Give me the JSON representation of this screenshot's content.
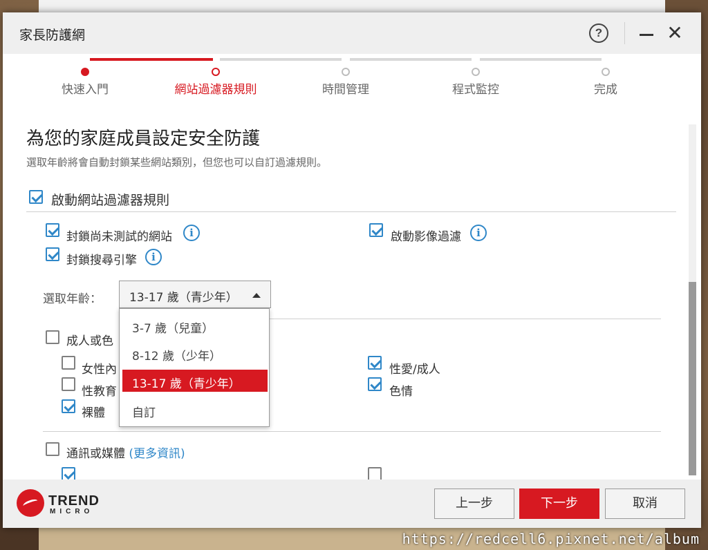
{
  "window": {
    "title": "家長防護網"
  },
  "titlebar": {
    "help_glyph": "?",
    "close_glyph": "✕"
  },
  "stepper": {
    "steps": [
      {
        "label": "快速入門",
        "state": "done"
      },
      {
        "label": "網站過濾器規則",
        "state": "current"
      },
      {
        "label": "時間管理",
        "state": "pending"
      },
      {
        "label": "程式監控",
        "state": "pending"
      },
      {
        "label": "完成",
        "state": "pending"
      }
    ]
  },
  "main": {
    "heading": "為您的家庭成員設定安全防護",
    "subheading": "選取年齡將會自動封鎖某些網站類別，但您也可以自訂過濾規則。",
    "enable_filter": {
      "label": "啟動網站過濾器規則",
      "checked": true
    },
    "options": [
      {
        "label": "封鎖尚未測試的網站",
        "checked": true,
        "info": true
      },
      {
        "label": "啟動影像過濾",
        "checked": true,
        "info": true
      },
      {
        "label": "封鎖搜尋引擎",
        "checked": true,
        "info": true
      }
    ],
    "age": {
      "label": "選取年齡：",
      "selected": "13-17 歲（青少年）",
      "options": [
        "3-7 歲（兒童）",
        "8-12 歲（少年）",
        "13-17 歲（青少年）",
        "自訂"
      ]
    },
    "categories": [
      {
        "label": "成人或色",
        "checked": false,
        "items": [
          {
            "label": "女性內",
            "checked": false
          },
          {
            "label": "性愛/成人",
            "checked": true
          },
          {
            "label": "性教育",
            "checked": false
          },
          {
            "label": "色情",
            "checked": true
          },
          {
            "label": "裸體",
            "checked": true
          }
        ]
      },
      {
        "label": "通訊或媒體",
        "more_link": "(更多資訊)",
        "checked": false
      }
    ],
    "info_glyph": "i"
  },
  "footer": {
    "logo_top": "TREND",
    "logo_bottom": "MICRO",
    "back_button": "上一步",
    "next_button": "下一步",
    "cancel_button": "取消"
  },
  "watermark": "https://redcell6.pixnet.net/album",
  "colors": {
    "accent": "#d71921",
    "check": "#2f87c8"
  }
}
